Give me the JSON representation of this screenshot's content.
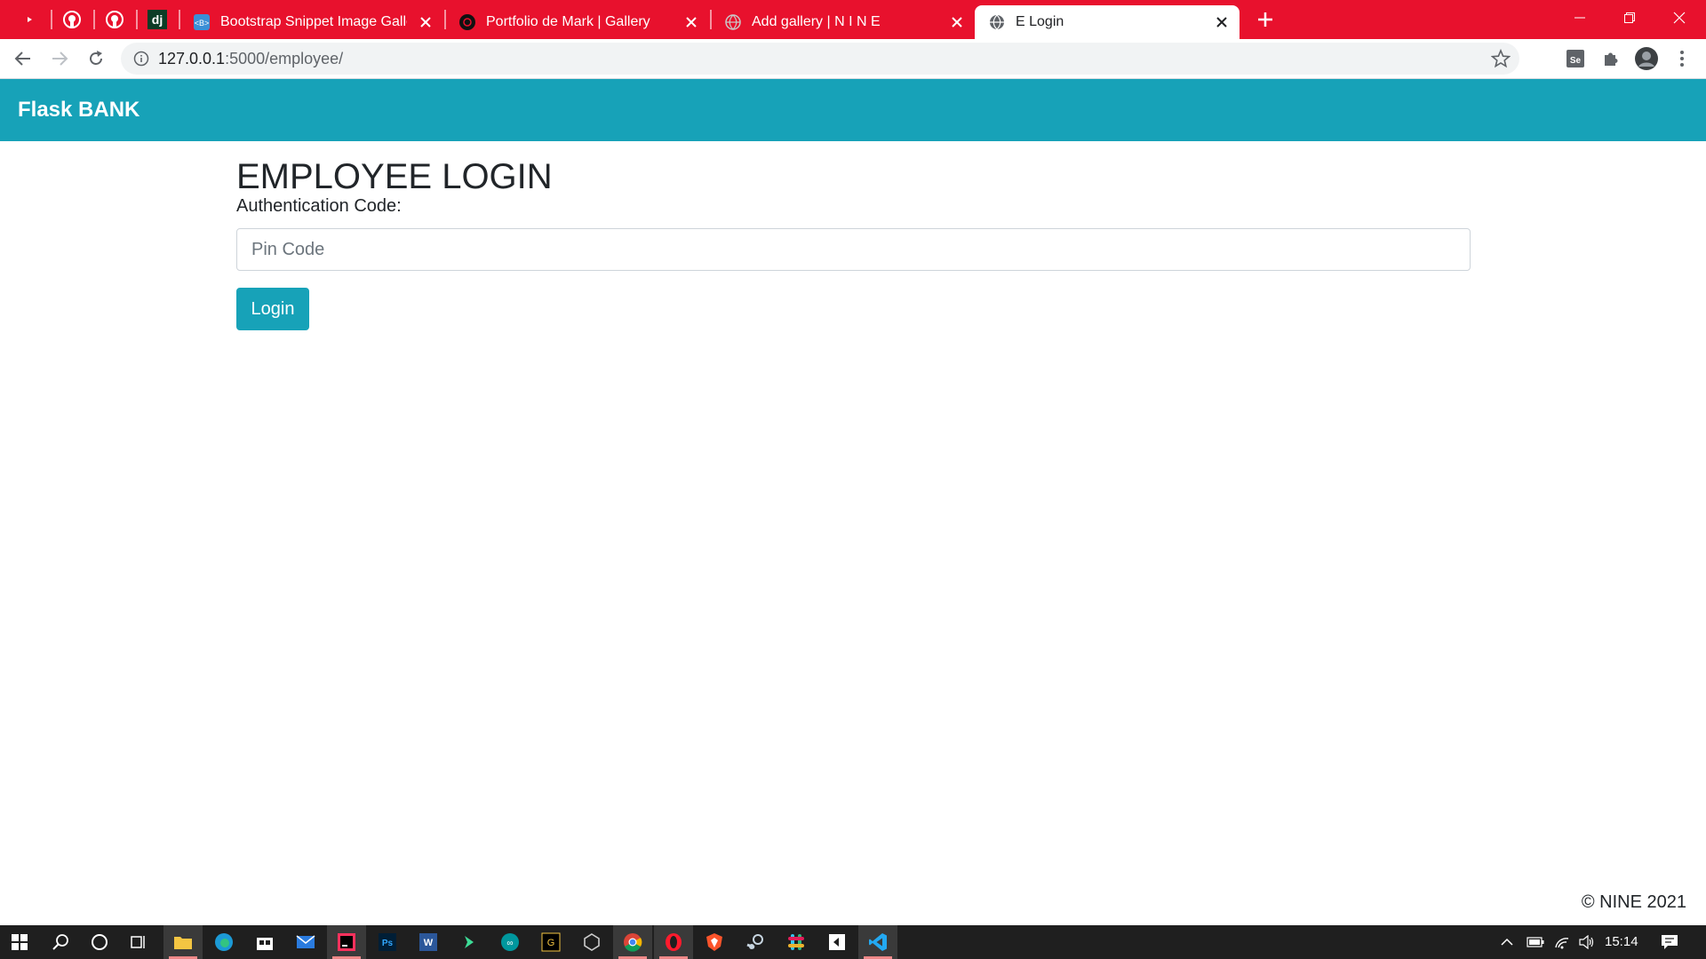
{
  "browser": {
    "pinned_tabs": [
      {
        "icon": "youtube-icon"
      },
      {
        "icon": "github-icon"
      },
      {
        "icon": "github-icon"
      },
      {
        "icon": "django-icon",
        "text": "dj"
      }
    ],
    "tabs": [
      {
        "title": "Bootstrap Snippet Image Gallery",
        "icon": "bootstrap-snippet-icon",
        "active": false
      },
      {
        "title": "Portfolio de Mark | Gallery",
        "icon": "portfolio-icon",
        "active": false
      },
      {
        "title": "Add gallery | N I N E",
        "icon": "globe-icon",
        "active": false
      },
      {
        "title": "E Login",
        "icon": "globe-icon",
        "active": true
      }
    ],
    "url_host": "127.0.0.1",
    "url_rest": ":5000/employee/",
    "accent_color": "#e8112d"
  },
  "navbar": {
    "brand": "Flask BANK",
    "color": "#17a2b8"
  },
  "form": {
    "heading": "EMPLOYEE LOGIN",
    "label": "Authentication Code:",
    "pin_placeholder": "Pin Code",
    "pin_value": "",
    "submit_label": "Login"
  },
  "footer": {
    "text": "© NINE 2021"
  },
  "taskbar": {
    "apps": [
      "start-icon",
      "search-icon",
      "cortana-icon",
      "task-view-icon",
      "file-explorer-icon",
      "edge-icon",
      "store-icon",
      "mail-icon",
      "intellij-icon",
      "photoshop-icon",
      "word-icon",
      "tool-icon",
      "arduino-icon",
      "app-g-icon",
      "unity-icon",
      "chrome-icon",
      "opera-icon",
      "brave-icon",
      "steam-icon",
      "slack-icon",
      "app-icon",
      "vscode-icon"
    ],
    "time": "15:14"
  }
}
